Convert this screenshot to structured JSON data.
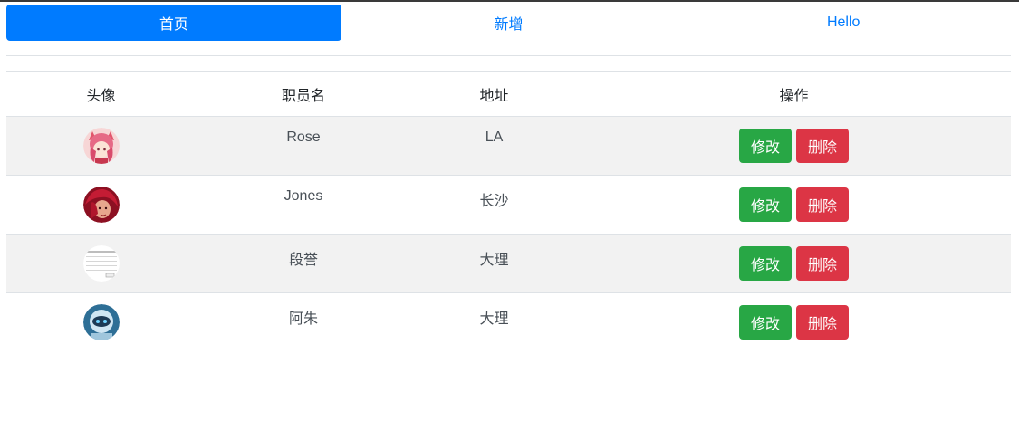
{
  "nav": {
    "items": [
      {
        "label": "首页",
        "active": true
      },
      {
        "label": "新增",
        "active": false
      },
      {
        "label": "Hello",
        "active": false
      }
    ]
  },
  "table": {
    "headers": [
      "头像",
      "职员名",
      "地址",
      "操作"
    ],
    "rows": [
      {
        "name": "Rose",
        "address": "LA",
        "edit_label": "修改",
        "delete_label": "删除",
        "avatar": "anime-pink-hair-avatar"
      },
      {
        "name": "Jones",
        "address": "长沙",
        "edit_label": "修改",
        "delete_label": "删除",
        "avatar": "red-hair-character-avatar"
      },
      {
        "name": "段誉",
        "address": "大理",
        "edit_label": "修改",
        "delete_label": "删除",
        "avatar": "document-screenshot-avatar"
      },
      {
        "name": "阿朱",
        "address": "大理",
        "edit_label": "修改",
        "delete_label": "删除",
        "avatar": "robot-avatar"
      }
    ]
  },
  "colors": {
    "primary": "#007bff",
    "success": "#28a745",
    "danger": "#dc3545",
    "stripe": "#f2f2f2"
  }
}
